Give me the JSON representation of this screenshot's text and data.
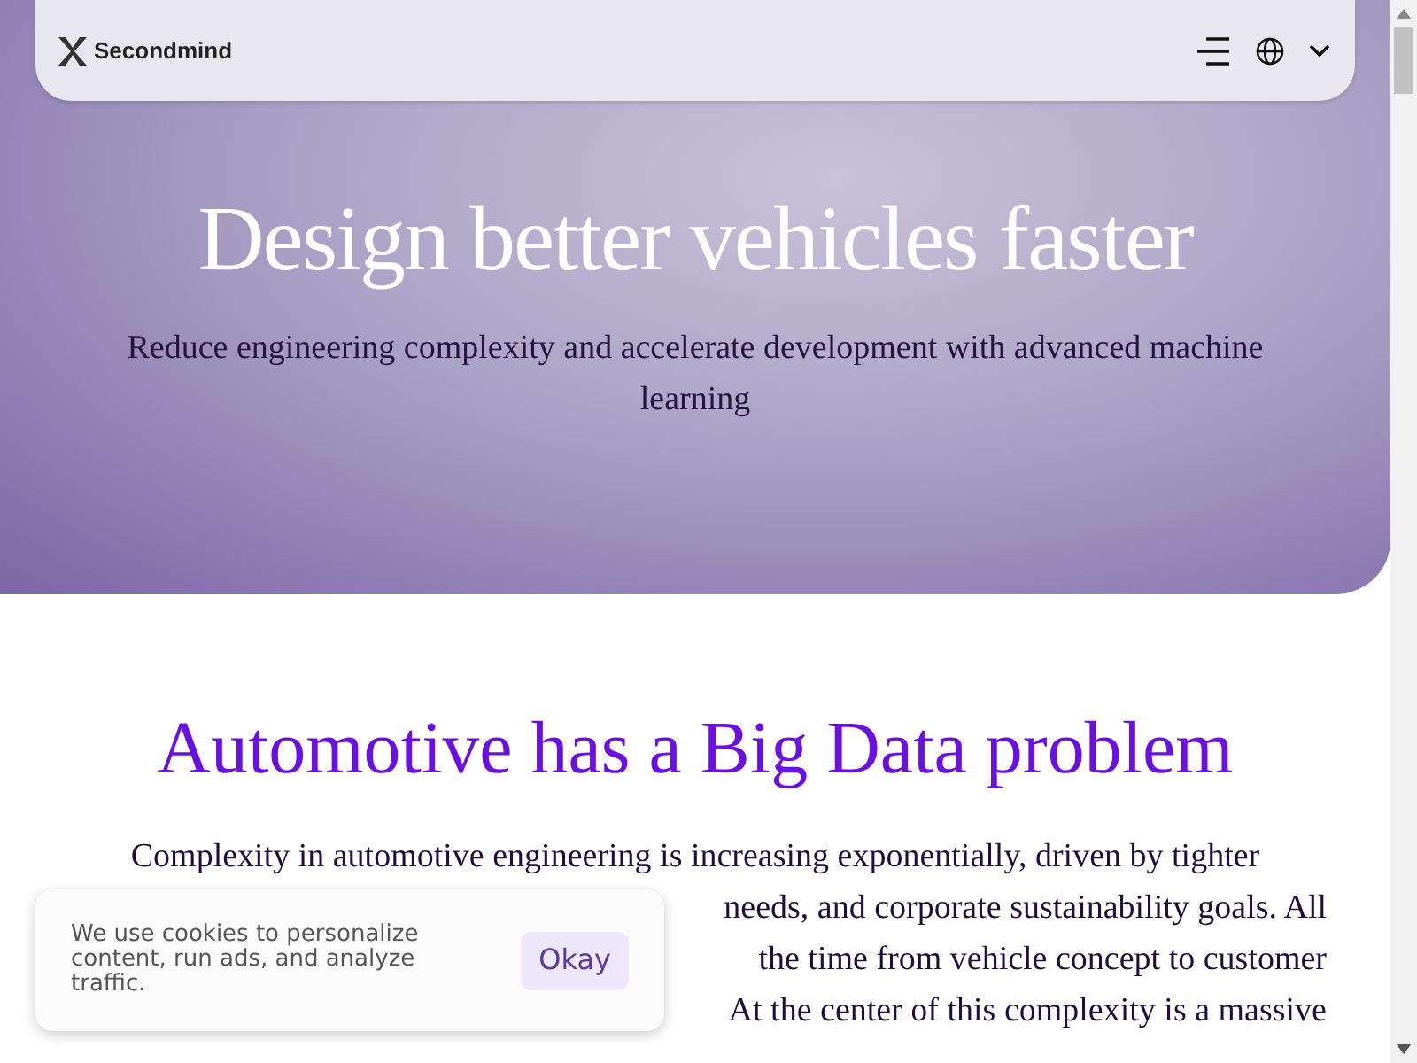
{
  "nav": {
    "brand": "Secondmind"
  },
  "hero": {
    "title": "Design better vehicles faster",
    "subtitle": "Reduce engineering complexity and accelerate development with advanced machine learning"
  },
  "section": {
    "title": "Automotive has a Big Data problem",
    "body_lines": [
      {
        "kind": "full",
        "text": "Complexity in automotive engineering is increasing exponentially, driven by tighter"
      },
      {
        "kind": "partial",
        "text": "needs, and corporate sustainability goals. All"
      },
      {
        "kind": "partial",
        "text": "the time from vehicle concept to customer"
      },
      {
        "kind": "partial",
        "text": "At the center of this complexity is a massive"
      }
    ]
  },
  "cookie_banner": {
    "message": "We use cookies to personalize content, run ads, and analyze traffic.",
    "button": "Okay"
  }
}
